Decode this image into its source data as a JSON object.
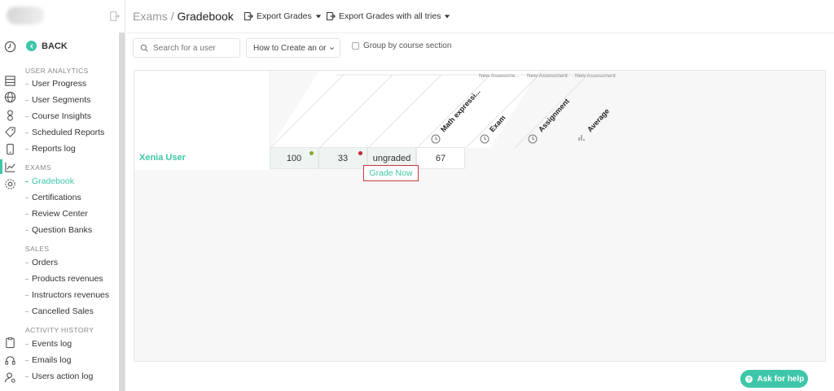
{
  "breadcrumb": {
    "parent": "Exams",
    "separator": "/",
    "current": "Gradebook"
  },
  "toolbar": {
    "export_grades": "Export Grades",
    "export_all_tries": "Export Grades with all tries"
  },
  "sidebar": {
    "back": "BACK",
    "sections": [
      {
        "title": "USER ANALYTICS",
        "items": [
          "User Progress",
          "User Segments",
          "Course Insights",
          "Scheduled Reports",
          "Reports log"
        ]
      },
      {
        "title": "EXAMS",
        "items": [
          "Gradebook",
          "Certifications",
          "Review Center",
          "Question Banks"
        ]
      },
      {
        "title": "SALES",
        "items": [
          "Orders",
          "Products revenues",
          "Instructors revenues",
          "Cancelled Sales"
        ]
      },
      {
        "title": "ACTIVITY HISTORY",
        "items": [
          "Events log",
          "Emails log",
          "Users action log"
        ]
      }
    ],
    "active_item": "Gradebook"
  },
  "filters": {
    "search_placeholder": "Search for a user",
    "course_select": "How to Create an or",
    "group_by_label": "Group by course section"
  },
  "gradebook": {
    "columns": [
      {
        "group": "New Assessme...",
        "name": "Math expressi..."
      },
      {
        "group": "New Assessment",
        "name": "Exam"
      },
      {
        "group": "New Assessment",
        "name": "Assignment"
      },
      {
        "group": "",
        "name": "Average"
      }
    ],
    "rows": [
      {
        "user": "Xenia User",
        "grades": [
          "100",
          "33",
          "ungraded",
          "67"
        ]
      }
    ],
    "grade_now": "Grade Now",
    "colors": {
      "accent": "#3ec6a8",
      "pass_marker": "#8aa832",
      "fail_marker": "#c0282f",
      "highlight": "#d0343c"
    }
  },
  "help_button": "Ask for help"
}
